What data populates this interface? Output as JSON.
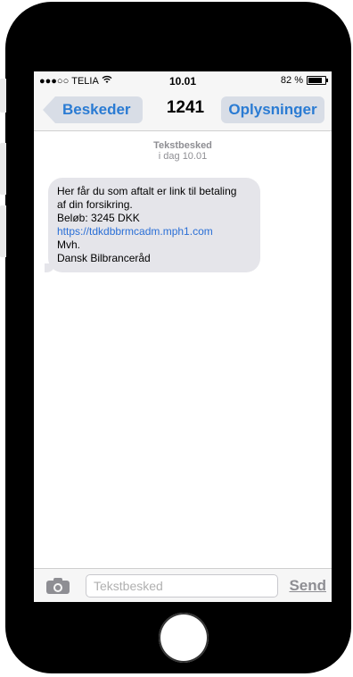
{
  "status_bar": {
    "signal": "●●●○○",
    "carrier": "TELIA",
    "wifi_icon": "wifi-icon",
    "time": "10.01",
    "battery_percent": "82 %",
    "battery_level": 0.82
  },
  "nav": {
    "back_label": "Beskeder",
    "title": "1241",
    "info_label": "Oplysninger"
  },
  "thread": {
    "meta_type": "Tekstbesked",
    "meta_time": "i dag 10.01",
    "message": {
      "line1": "Her får du som aftalt er link til betaling",
      "line2": "af din forsikring.",
      "line3": "Beløb: 3245 DKK",
      "link": "https://tdkdbbrmcadm.mph1.com",
      "line5": "Mvh.",
      "line6": "Dansk Bilbranceråd"
    }
  },
  "input_bar": {
    "camera_icon": "camera-icon",
    "placeholder": "Tekstbesked",
    "send_label": "Send"
  }
}
